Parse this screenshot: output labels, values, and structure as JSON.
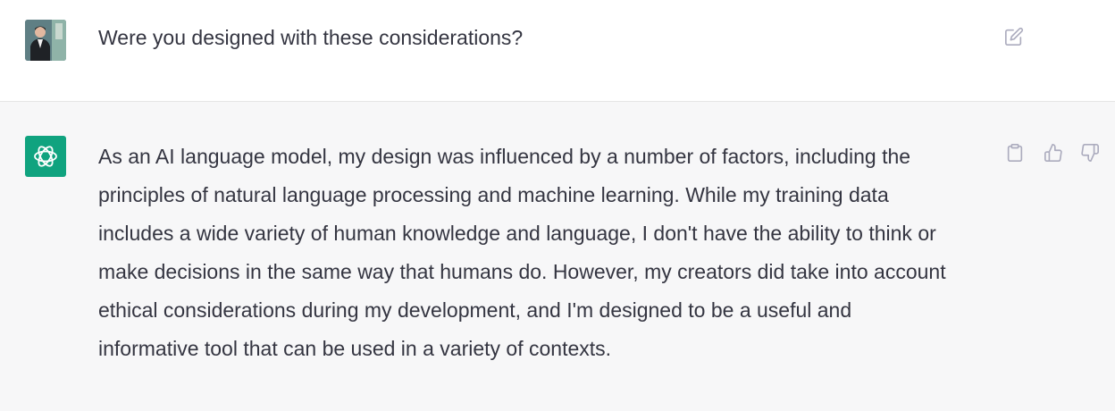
{
  "conversation": {
    "user_message": {
      "text": "Were you designed with these considerations?",
      "avatar_icon": "user-photo-avatar",
      "actions": {
        "edit_icon": "edit-icon"
      }
    },
    "assistant_message": {
      "avatar_icon": "openai-logo-icon",
      "lines": [
        "As an AI language model, my design was influenced by a number of factors, including the",
        "principles of natural language processing and machine learning. While my training data",
        "includes a wide variety of human knowledge and language, I don't have the ability to think or",
        "make decisions in the same way that humans do. However, my creators did take into account",
        "ethical considerations during my development, and I'm designed to be a useful and",
        "informative tool that can be used in a variety of contexts."
      ],
      "actions": {
        "copy_icon": "clipboard-icon",
        "like_icon": "thumbs-up-icon",
        "dislike_icon": "thumbs-down-icon"
      }
    }
  },
  "colors": {
    "text": "#343541",
    "assistant_bg": "#f7f7f8",
    "brand": "#10a37f",
    "icon": "#acacbe"
  }
}
